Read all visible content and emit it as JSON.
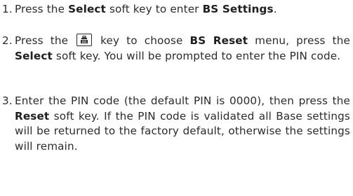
{
  "steps": [
    {
      "number": "1.",
      "parts": [
        "Press the ",
        "Select",
        " soft key to enter ",
        "BS Settings",
        "."
      ]
    },
    {
      "number": "2.",
      "parts": [
        "Press the ",
        " key to choose ",
        "BS Reset",
        " menu, press the ",
        "Select",
        " soft key. You will be prompted to enter the PIN code."
      ],
      "key_icon": "phonebook-key-icon"
    },
    {
      "number": "3.",
      "parts": [
        "Enter the PIN code (the default PIN is 0000), then press the ",
        "Reset",
        " soft key. If the PIN code is validated all Base settings will be returned to the factory default, otherwise the settings will remain."
      ]
    }
  ]
}
